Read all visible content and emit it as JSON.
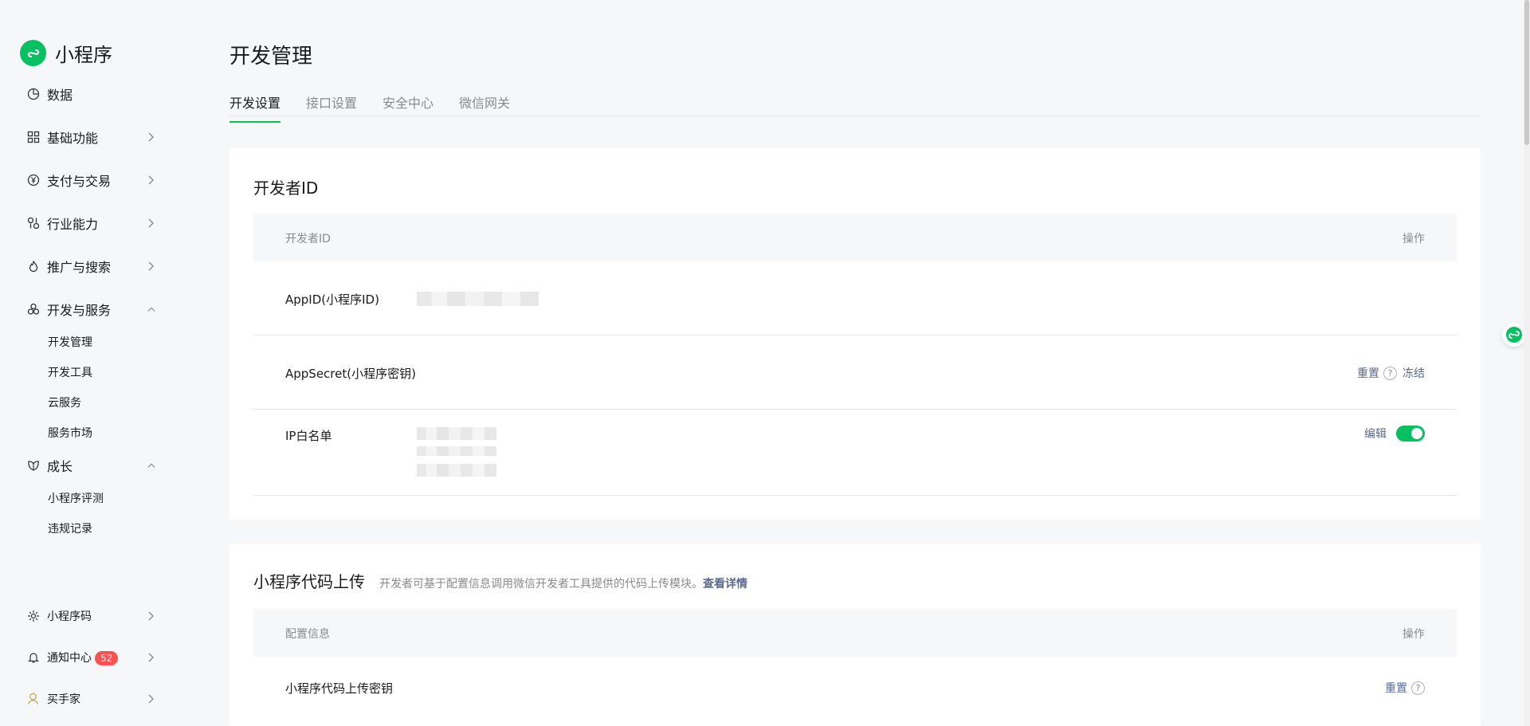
{
  "brand": {
    "name": "小程序",
    "accent": "#07c160",
    "link_color": "#576b95",
    "badge_color": "#fa5151"
  },
  "sidebar": {
    "items": [
      {
        "label": "数据",
        "icon": "pie-chart-icon"
      },
      {
        "label": "基础功能",
        "icon": "grid-icon"
      },
      {
        "label": "支付与交易",
        "icon": "yen-circle-icon"
      },
      {
        "label": "行业能力",
        "icon": "industry-icon"
      },
      {
        "label": "推广与搜索",
        "icon": "flame-icon"
      },
      {
        "label": "开发与服务",
        "icon": "circles-icon"
      },
      {
        "label": "成长",
        "icon": "leaf-icon"
      }
    ],
    "dev_subitems": [
      "开发管理",
      "开发工具",
      "云服务",
      "服务市场"
    ],
    "growth_subitems": [
      "小程序评测",
      "违规记录"
    ],
    "bottom": [
      {
        "label": "小程序码",
        "icon": "qrcode-sun-icon"
      },
      {
        "label": "通知中心",
        "icon": "bell-icon",
        "badge": "52"
      },
      {
        "label": "买手家",
        "icon": "buyer-icon"
      }
    ]
  },
  "page": {
    "title": "开发管理",
    "tabs": [
      "开发设置",
      "接口设置",
      "安全中心",
      "微信网关"
    ],
    "active_tab": "开发设置"
  },
  "developer_id": {
    "title": "开发者ID",
    "col_left": "开发者ID",
    "col_right": "操作",
    "rows": [
      {
        "name": "AppID(小程序ID)"
      },
      {
        "name": "AppSecret(小程序密钥)",
        "op_reset": "重置",
        "op_freeze": "冻结"
      },
      {
        "name": "IP白名单",
        "op_edit": "编辑",
        "toggle_on": true
      }
    ]
  },
  "code_upload": {
    "title": "小程序代码上传",
    "desc": "开发者可基于配置信息调用微信开发者工具提供的代码上传模块。",
    "desc_link": "查看详情",
    "col_left": "配置信息",
    "col_right": "操作",
    "rows": [
      {
        "name": "小程序代码上传密钥",
        "op_reset": "重置"
      }
    ]
  }
}
